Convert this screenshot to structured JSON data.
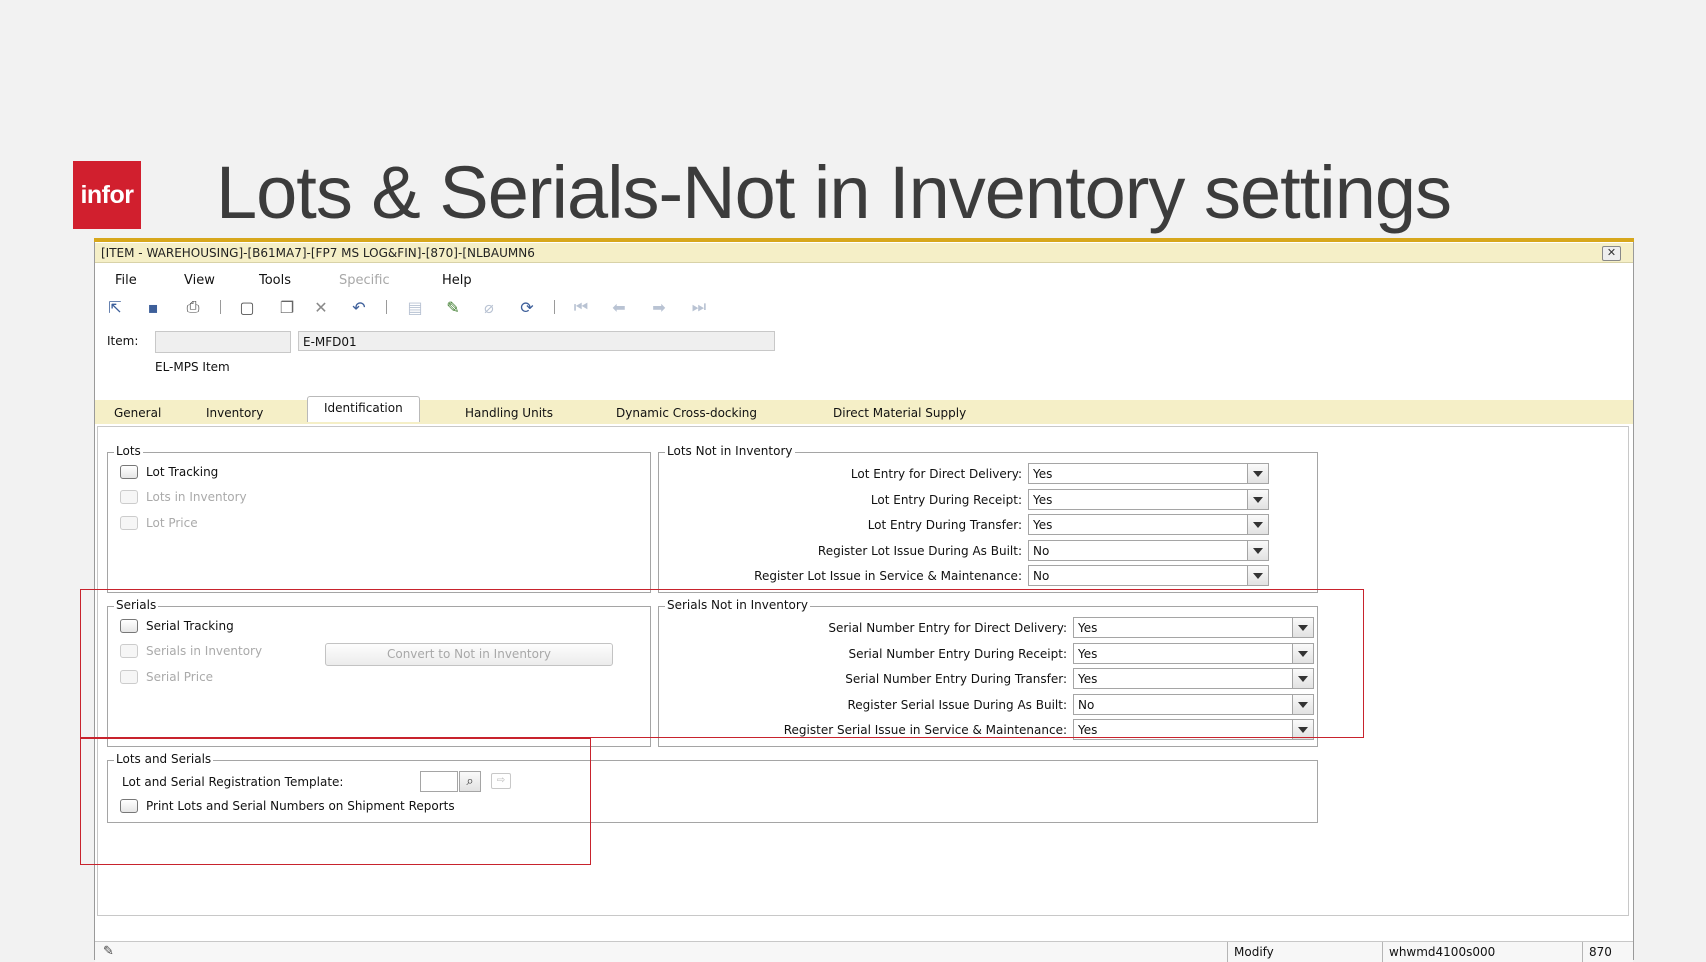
{
  "slide": {
    "logo_text": "infor",
    "title": "Lots & Serials-Not in Inventory settings"
  },
  "window": {
    "title": "[ITEM - WAREHOUSING]-[B61MA7]-[FP7 MS LOG&FIN]-[870]-[NLBAUMN6",
    "close_symbol": "✕"
  },
  "menu": {
    "file": "File",
    "view": "View",
    "tools": "Tools",
    "specific": "Specific",
    "help": "Help"
  },
  "toolbar_icons": [
    "save-and-close-icon",
    "save-icon",
    "print-icon",
    "new-icon",
    "copy-icon",
    "delete-icon",
    "undo-icon",
    "attachment-icon",
    "edit-icon",
    "paperclip-icon",
    "refresh-icon",
    "first-record-icon",
    "previous-record-icon",
    "next-record-icon",
    "last-record-icon"
  ],
  "item": {
    "label": "Item:",
    "project_value": "",
    "code": "E-MFD01",
    "description": "EL-MPS Item"
  },
  "tabs": {
    "general": "General",
    "inventory": "Inventory",
    "identification": "Identification",
    "handling_units": "Handling Units",
    "dynamic_cross_docking": "Dynamic Cross-docking",
    "direct_material_supply": "Direct Material Supply"
  },
  "lots": {
    "title": "Lots",
    "lot_tracking": "Lot Tracking",
    "lots_in_inventory": "Lots in Inventory",
    "lot_price": "Lot Price"
  },
  "lots_not_in_inventory": {
    "title": "Lots Not in Inventory",
    "rows": [
      {
        "label": "Lot Entry for Direct Delivery:",
        "value": "Yes"
      },
      {
        "label": "Lot Entry During Receipt:",
        "value": "Yes"
      },
      {
        "label": "Lot Entry During Transfer:",
        "value": "Yes"
      },
      {
        "label": "Register Lot Issue During As Built:",
        "value": "No"
      },
      {
        "label": "Register Lot Issue in Service & Maintenance:",
        "value": "No"
      }
    ]
  },
  "serials": {
    "title": "Serials",
    "serial_tracking": "Serial Tracking",
    "serials_in_inventory": "Serials in Inventory",
    "serial_price": "Serial Price",
    "convert_button": "Convert to Not in Inventory"
  },
  "serials_not_in_inventory": {
    "title": "Serials Not in Inventory",
    "rows": [
      {
        "label": "Serial Number Entry for Direct Delivery:",
        "value": "Yes"
      },
      {
        "label": "Serial Number Entry During Receipt:",
        "value": "Yes"
      },
      {
        "label": "Serial Number Entry During Transfer:",
        "value": "Yes"
      },
      {
        "label": "Register Serial Issue During As Built:",
        "value": "No"
      },
      {
        "label": "Register Serial Issue in Service & Maintenance:",
        "value": "Yes"
      }
    ]
  },
  "lots_and_serials": {
    "title": "Lots and Serials",
    "template_label": "Lot and Serial Registration Template:",
    "template_value": "",
    "print_label": "Print Lots and Serial Numbers on Shipment Reports"
  },
  "status": {
    "mode": "Modify",
    "session": "whwmd4100s000",
    "company": "870"
  },
  "colors": {
    "accent": "#d7a71c",
    "logo_red": "#d11f2e",
    "highlight_red": "#c8232d",
    "band": "#f5efc7"
  }
}
